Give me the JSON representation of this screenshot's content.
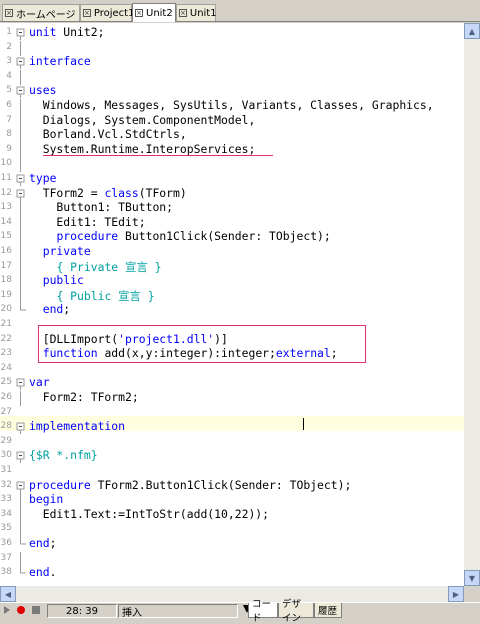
{
  "tabs": [
    {
      "label": "ホームページ",
      "active": false
    },
    {
      "label": "Project1",
      "active": false
    },
    {
      "label": "Unit2",
      "active": true
    },
    {
      "label": "Unit1",
      "active": false
    }
  ],
  "code_lines": [
    {
      "n": "1",
      "text": "unit Unit2;"
    },
    {
      "n": "2",
      "text": ""
    },
    {
      "n": "3",
      "text": "interface"
    },
    {
      "n": "4",
      "text": ""
    },
    {
      "n": "5",
      "text": "uses"
    },
    {
      "n": "6",
      "text": "  Windows, Messages, SysUtils, Variants, Classes, Graphics,"
    },
    {
      "n": "7",
      "text": "  Dialogs, System.ComponentModel,"
    },
    {
      "n": "8",
      "text": "  Borland.Vcl.StdCtrls,"
    },
    {
      "n": "9",
      "text": "  System.Runtime.InteropServices;"
    },
    {
      "n": "10",
      "text": ""
    },
    {
      "n": "11",
      "text": "type"
    },
    {
      "n": "12",
      "text": "  TForm2 = class(TForm)"
    },
    {
      "n": "13",
      "text": "    Button1: TButton;"
    },
    {
      "n": "14",
      "text": "    Edit1: TEdit;"
    },
    {
      "n": "15",
      "text": "    procedure Button1Click(Sender: TObject);"
    },
    {
      "n": "16",
      "text": "  private"
    },
    {
      "n": "17",
      "text": "    { Private 宣言 }"
    },
    {
      "n": "18",
      "text": "  public"
    },
    {
      "n": "19",
      "text": "    { Public 宣言 }"
    },
    {
      "n": "20",
      "text": "  end;"
    },
    {
      "n": "21",
      "text": ""
    },
    {
      "n": "22",
      "text": "  [DLLImport('project1.dll')]"
    },
    {
      "n": "23",
      "text": "  function add(x,y:integer):integer;external;"
    },
    {
      "n": "24",
      "text": ""
    },
    {
      "n": "25",
      "text": "var"
    },
    {
      "n": "26",
      "text": "  Form2: TForm2;"
    },
    {
      "n": "27",
      "text": ""
    },
    {
      "n": "28",
      "text": "implementation"
    },
    {
      "n": "29",
      "text": ""
    },
    {
      "n": "30",
      "text": "{$R *.nfm}"
    },
    {
      "n": "31",
      "text": ""
    },
    {
      "n": "32",
      "text": "procedure TForm2.Button1Click(Sender: TObject);"
    },
    {
      "n": "33",
      "text": "begin"
    },
    {
      "n": "34",
      "text": "  Edit1.Text:=IntToStr(add(10,22));"
    },
    {
      "n": "35",
      "text": ""
    },
    {
      "n": "36",
      "text": "end;"
    },
    {
      "n": "37",
      "text": ""
    },
    {
      "n": "38",
      "text": "end."
    }
  ],
  "status": {
    "position": "28: 39",
    "mode": "挿入"
  },
  "bottom_tabs": [
    {
      "label": "コード",
      "active": true
    },
    {
      "label": "デザイン",
      "active": false
    },
    {
      "label": "履歴",
      "active": false
    }
  ],
  "colors": {
    "keyword": "#0000ff",
    "comment": "#00a0a0",
    "highlight_box": "#e0306a",
    "current_line": "#ffffe0"
  }
}
